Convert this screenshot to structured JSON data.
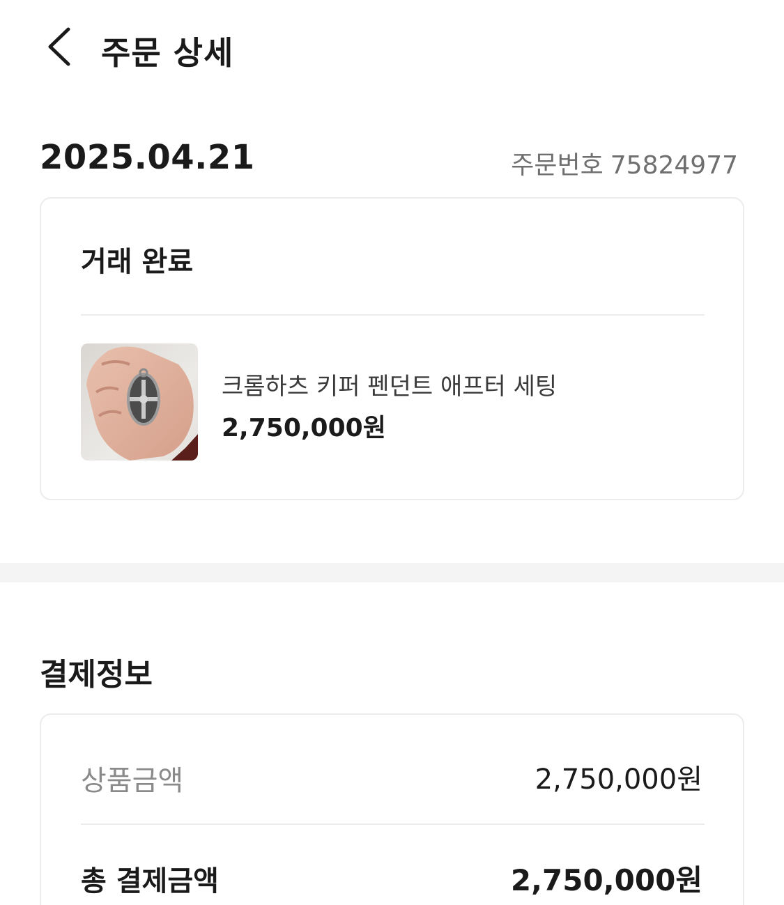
{
  "header": {
    "back_icon": "chevron-left-icon",
    "title": "주문 상세"
  },
  "order": {
    "date": "2025.04.21",
    "number_label": "주문번호",
    "number_value": "75824977",
    "status": "거래 완료",
    "product": {
      "name": "크롬하츠 키퍼 펜던트 애프터 세팅",
      "price": "2,750,000원"
    }
  },
  "payment": {
    "title": "결제정보",
    "product_amount_label": "상품금액",
    "product_amount_value": "2,750,000원",
    "total_label": "총 결제금액",
    "total_value": "2,750,000원"
  }
}
